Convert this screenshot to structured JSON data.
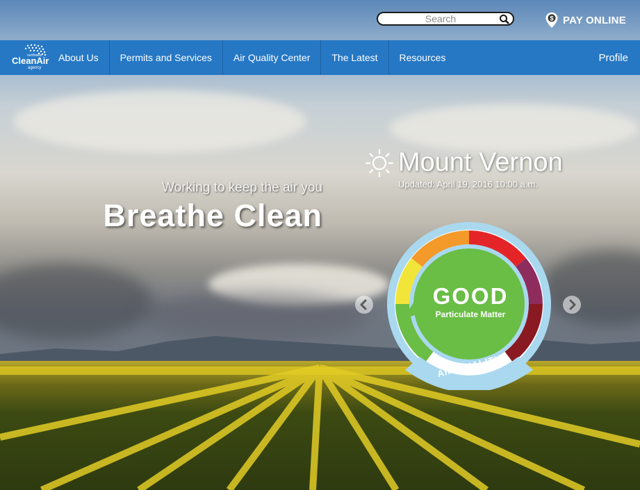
{
  "search": {
    "placeholder": "Search"
  },
  "pay": {
    "label": "PAY ONLINE"
  },
  "logo": {
    "line1": "northwest",
    "line2": "CleanAir",
    "line3": "agency"
  },
  "nav": {
    "items": [
      {
        "label": "About Us"
      },
      {
        "label": "Permits and Services"
      },
      {
        "label": "Air Quality Center"
      },
      {
        "label": "The Latest"
      },
      {
        "label": "Resources"
      }
    ],
    "profile": "Profile"
  },
  "hero": {
    "tagline": "Working to keep the air you",
    "headline": "Breathe Clean"
  },
  "air_quality": {
    "city": "Mount Vernon",
    "updated": "Updated: April 19, 2016 10:00 a.m.",
    "status": "GOOD",
    "pollutant": "Particulate Matter",
    "label": "AIR QUALITY",
    "status_color": "#6abd45",
    "scale_colors": [
      "#6abd45",
      "#f2e53a",
      "#f39a2a",
      "#e42528",
      "#8e2c5e",
      "#8a1a22"
    ]
  },
  "colors": {
    "nav": "#2678c5",
    "text": "#ffffff"
  },
  "icons": {
    "search": "search-icon",
    "pay": "map-pin-dollar-icon",
    "weather": "sun-icon",
    "prev": "chevron-left-icon",
    "next": "chevron-right-icon"
  }
}
